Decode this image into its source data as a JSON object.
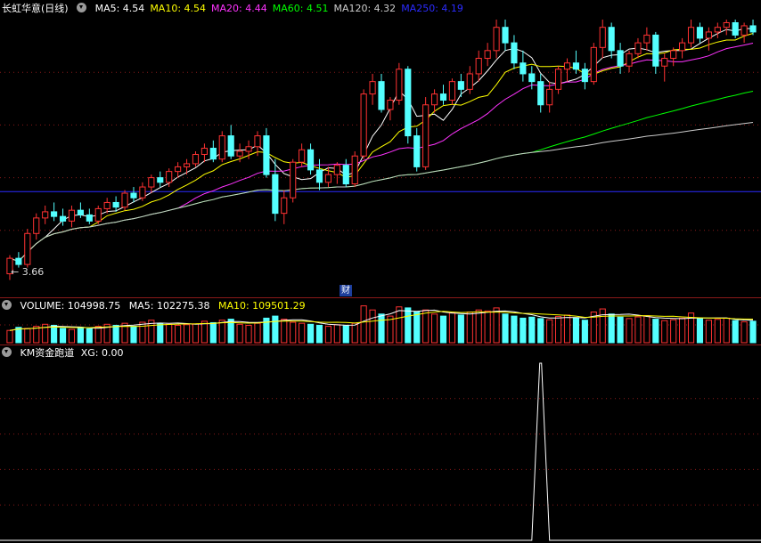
{
  "colors": {
    "up": "#ff3232",
    "down": "#54ffff",
    "ma5": "#ffffff",
    "ma10": "#ffff00",
    "ma20": "#ff33ff",
    "ma60": "#00ff00",
    "ma120": "#cccccc",
    "ma250": "#2b2bff",
    "grid": "#8a1a1a",
    "xg_line": "#ffffff"
  },
  "main_panel": {
    "title": "长虹华意(日线)",
    "ma_labels": [
      {
        "name": "MA5",
        "text": "MA5: 4.54",
        "color": "#ffffff"
      },
      {
        "name": "MA10",
        "text": "MA10: 4.54",
        "color": "#ffff00"
      },
      {
        "name": "MA20",
        "text": "MA20: 4.44",
        "color": "#ff33ff"
      },
      {
        "name": "MA60",
        "text": "MA60: 4.51",
        "color": "#00ff00"
      },
      {
        "name": "MA120",
        "text": "MA120: 4.32",
        "color": "#cccccc"
      },
      {
        "name": "MA250",
        "text": "MA250: 4.19",
        "color": "#2b2bff"
      }
    ],
    "min_label": "3.66",
    "finance_badge": "财"
  },
  "volume_panel": {
    "title": "VOLUME: 104998.75",
    "ma5_label": "MA5: 102275.38",
    "ma10_label": "MA10: 109501.29"
  },
  "indicator_panel": {
    "title": "KM资金跑道",
    "xg_label": "XG: 0.00"
  },
  "chart_data": [
    {
      "type": "candlestick",
      "name": "price",
      "ylim": [
        3.6,
        5.3
      ],
      "grid": true,
      "candles": [
        [
          3.66,
          3.78,
          3.62,
          3.76
        ],
        [
          3.76,
          3.8,
          3.7,
          3.72
        ],
        [
          3.72,
          3.95,
          3.7,
          3.92
        ],
        [
          3.92,
          4.05,
          3.88,
          4.02
        ],
        [
          4.02,
          4.1,
          3.98,
          4.06
        ],
        [
          4.06,
          4.12,
          4.0,
          4.03
        ],
        [
          4.03,
          4.08,
          3.97,
          4.0
        ],
        [
          4.0,
          4.1,
          3.96,
          4.07
        ],
        [
          4.07,
          4.12,
          4.02,
          4.04
        ],
        [
          4.04,
          4.08,
          3.98,
          4.0
        ],
        [
          4.0,
          4.1,
          3.98,
          4.08
        ],
        [
          4.08,
          4.15,
          4.05,
          4.12
        ],
        [
          4.12,
          4.16,
          4.06,
          4.09
        ],
        [
          4.09,
          4.2,
          4.07,
          4.18
        ],
        [
          4.18,
          4.22,
          4.12,
          4.15
        ],
        [
          4.15,
          4.25,
          4.13,
          4.22
        ],
        [
          4.22,
          4.3,
          4.18,
          4.28
        ],
        [
          4.28,
          4.32,
          4.22,
          4.25
        ],
        [
          4.25,
          4.34,
          4.22,
          4.32
        ],
        [
          4.32,
          4.38,
          4.28,
          4.35
        ],
        [
          4.35,
          4.4,
          4.3,
          4.37
        ],
        [
          4.37,
          4.45,
          4.35,
          4.43
        ],
        [
          4.43,
          4.5,
          4.38,
          4.47
        ],
        [
          4.47,
          4.52,
          4.38,
          4.4
        ],
        [
          4.4,
          4.58,
          4.38,
          4.55
        ],
        [
          4.55,
          4.62,
          4.4,
          4.42
        ],
        [
          4.42,
          4.5,
          4.38,
          4.45
        ],
        [
          4.45,
          4.52,
          4.4,
          4.48
        ],
        [
          4.48,
          4.58,
          4.42,
          4.55
        ],
        [
          4.55,
          4.6,
          4.28,
          4.3
        ],
        [
          4.3,
          4.4,
          4.0,
          4.05
        ],
        [
          4.05,
          4.2,
          3.98,
          4.15
        ],
        [
          4.15,
          4.4,
          4.12,
          4.38
        ],
        [
          4.38,
          4.5,
          4.35,
          4.46
        ],
        [
          4.46,
          4.5,
          4.3,
          4.33
        ],
        [
          4.33,
          4.4,
          4.2,
          4.25
        ],
        [
          4.25,
          4.35,
          4.22,
          4.3
        ],
        [
          4.3,
          4.38,
          4.24,
          4.36
        ],
        [
          4.36,
          4.4,
          4.22,
          4.24
        ],
        [
          4.24,
          4.45,
          4.22,
          4.42
        ],
        [
          4.42,
          4.85,
          4.4,
          4.82
        ],
        [
          4.82,
          4.95,
          4.75,
          4.9
        ],
        [
          4.9,
          4.95,
          4.7,
          4.72
        ],
        [
          4.72,
          4.8,
          4.65,
          4.78
        ],
        [
          4.78,
          5.02,
          4.75,
          4.98
        ],
        [
          4.98,
          5.0,
          4.5,
          4.55
        ],
        [
          4.55,
          4.6,
          4.32,
          4.35
        ],
        [
          4.35,
          4.8,
          4.33,
          4.75
        ],
        [
          4.75,
          4.85,
          4.7,
          4.82
        ],
        [
          4.82,
          4.88,
          4.75,
          4.78
        ],
        [
          4.78,
          4.92,
          4.75,
          4.9
        ],
        [
          4.9,
          4.95,
          4.8,
          4.85
        ],
        [
          4.85,
          5.0,
          4.82,
          4.95
        ],
        [
          4.95,
          5.1,
          4.9,
          5.05
        ],
        [
          5.05,
          5.15,
          5.0,
          5.1
        ],
        [
          5.1,
          5.3,
          5.05,
          5.25
        ],
        [
          5.25,
          5.3,
          5.1,
          5.15
        ],
        [
          5.15,
          5.2,
          4.98,
          5.02
        ],
        [
          5.02,
          5.1,
          4.9,
          4.95
        ],
        [
          4.95,
          5.0,
          4.85,
          4.9
        ],
        [
          4.9,
          4.95,
          4.7,
          4.75
        ],
        [
          4.75,
          4.9,
          4.7,
          4.85
        ],
        [
          4.85,
          5.0,
          4.82,
          4.98
        ],
        [
          4.98,
          5.05,
          4.9,
          5.02
        ],
        [
          5.02,
          5.1,
          4.95,
          4.98
        ],
        [
          4.98,
          5.02,
          4.85,
          4.9
        ],
        [
          4.9,
          5.15,
          4.88,
          5.12
        ],
        [
          5.12,
          5.3,
          5.05,
          5.25
        ],
        [
          5.25,
          5.28,
          5.05,
          5.1
        ],
        [
          5.1,
          5.15,
          4.95,
          5.0
        ],
        [
          5.0,
          5.1,
          4.96,
          5.08
        ],
        [
          5.08,
          5.18,
          5.05,
          5.15
        ],
        [
          5.15,
          5.25,
          5.1,
          5.2
        ],
        [
          5.2,
          5.22,
          4.95,
          5.0
        ],
        [
          5.0,
          5.08,
          4.9,
          5.05
        ],
        [
          5.05,
          5.12,
          5.0,
          5.1
        ],
        [
          5.1,
          5.18,
          5.05,
          5.15
        ],
        [
          5.15,
          5.3,
          5.12,
          5.25
        ],
        [
          5.25,
          5.28,
          5.15,
          5.18
        ],
        [
          5.18,
          5.25,
          5.1,
          5.22
        ],
        [
          5.22,
          5.28,
          5.18,
          5.25
        ],
        [
          5.25,
          5.3,
          5.2,
          5.28
        ],
        [
          5.28,
          5.3,
          5.18,
          5.2
        ],
        [
          5.2,
          5.28,
          5.15,
          5.26
        ],
        [
          5.26,
          5.3,
          5.2,
          5.22
        ]
      ],
      "ma_windows": {
        "MA5": 5,
        "MA10": 10,
        "MA20": 20,
        "MA60": 60,
        "MA120": 120
      },
      "ma250_level": 4.19
    },
    {
      "type": "bar",
      "name": "volume",
      "ylim": [
        0,
        200000
      ],
      "values": [
        60000,
        75000,
        70000,
        80000,
        90000,
        85000,
        70000,
        65000,
        72000,
        68000,
        80000,
        90000,
        85000,
        95000,
        80000,
        100000,
        110000,
        95000,
        90000,
        85000,
        88000,
        92000,
        105000,
        98000,
        110000,
        115000,
        90000,
        85000,
        95000,
        120000,
        130000,
        115000,
        100000,
        95000,
        90000,
        85000,
        80000,
        88000,
        82000,
        95000,
        180000,
        160000,
        140000,
        130000,
        175000,
        170000,
        150000,
        160000,
        140000,
        130000,
        145000,
        135000,
        150000,
        160000,
        155000,
        170000,
        140000,
        130000,
        120000,
        125000,
        118000,
        112000,
        128000,
        135000,
        122000,
        110000,
        150000,
        165000,
        140000,
        125000,
        118000,
        126000,
        132000,
        115000,
        108000,
        112000,
        120000,
        145000,
        118000,
        110000,
        114000,
        120000,
        108000,
        102000,
        104998.75
      ]
    },
    {
      "type": "line",
      "name": "XG",
      "ylim": [
        0,
        1
      ],
      "spike_index": 60,
      "spike_value": 1
    }
  ]
}
